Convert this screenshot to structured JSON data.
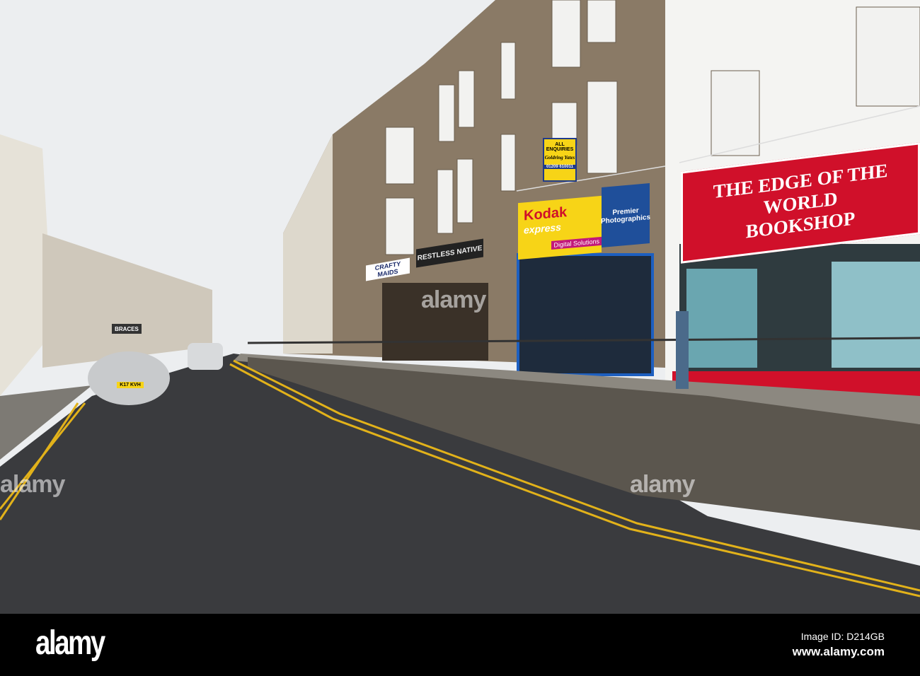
{
  "photo": {
    "signs": {
      "bookshop_line1": "THE EDGE OF THE WORLD",
      "bookshop_line2": "BOOKSHOP",
      "kodak_brand": "Kodak",
      "kodak_sub": "express",
      "kodak_tagline": "Digital Solutions",
      "premier": "Premier Photographics",
      "agent_top": "ALL ENQUIRIES",
      "agent_name": "Goldring Yates",
      "agent_phone": "01209 610011",
      "restless": "RESTLESS NATIVE",
      "crafty": "CRAFTY MAIDS",
      "braces": "BRACES",
      "plate": "K17 KVH"
    },
    "colors": {
      "sky": "#eceef0",
      "road": "#3a3b3e",
      "stone": "#8a7a66",
      "bookshop_red": "#d0102a",
      "kodak_yellow": "#f7d417",
      "premier_blue": "#1f4f9a",
      "yellow_line": "#e2b21a"
    }
  },
  "watermark": "alamy",
  "footer": {
    "logo": "alamy",
    "image_id": "Image ID: D214GB",
    "url": "www.alamy.com"
  }
}
